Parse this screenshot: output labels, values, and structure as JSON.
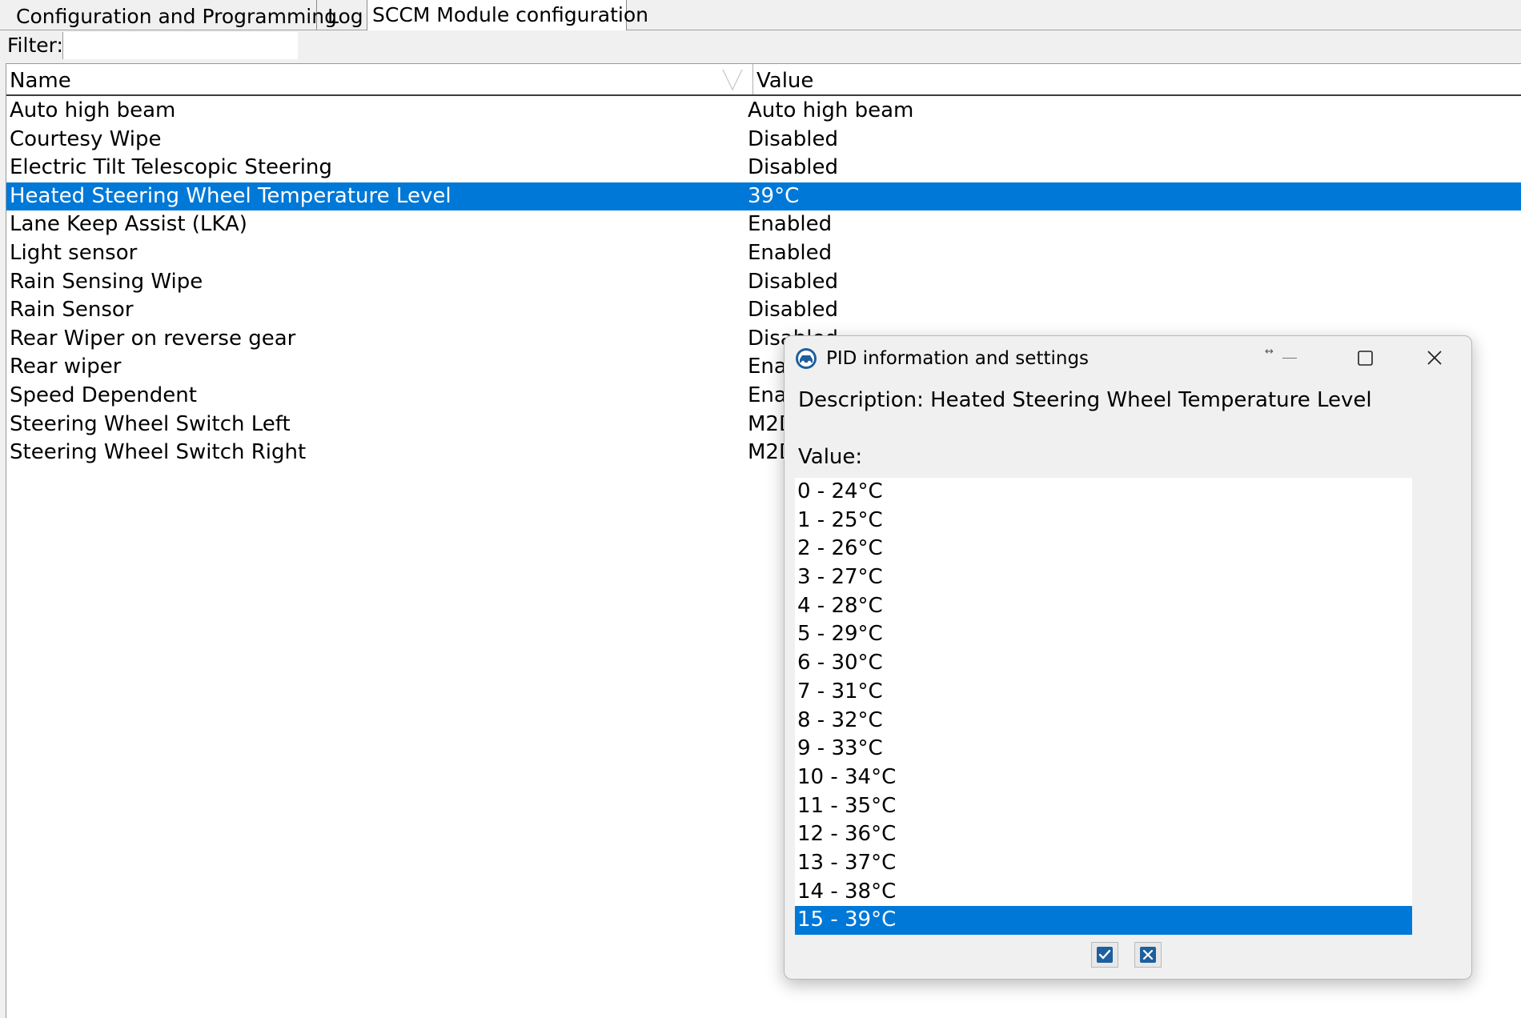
{
  "tabs": [
    {
      "label": "Configuration and Programming"
    },
    {
      "label": "Log"
    },
    {
      "label": "SCCM Module configuration"
    }
  ],
  "filter": {
    "label": "Filter:",
    "value": ""
  },
  "grid": {
    "columns": [
      "Name",
      "Value"
    ],
    "rows": [
      {
        "name": "Auto high beam",
        "value": "Auto high beam"
      },
      {
        "name": "Courtesy Wipe",
        "value": "Disabled"
      },
      {
        "name": "Electric Tilt Telescopic Steering",
        "value": "Disabled"
      },
      {
        "name": "Heated Steering Wheel Temperature Level",
        "value": "39°C"
      },
      {
        "name": "Lane Keep Assist (LKA)",
        "value": "Enabled"
      },
      {
        "name": "Light sensor",
        "value": "Enabled"
      },
      {
        "name": "Rain Sensing Wipe",
        "value": "Disabled"
      },
      {
        "name": "Rain Sensor",
        "value": "Disabled"
      },
      {
        "name": "Rear Wiper on reverse gear",
        "value": "Disabled"
      },
      {
        "name": "Rear wiper",
        "value": "Enabled"
      },
      {
        "name": "Speed Dependent",
        "value": "Enabled"
      },
      {
        "name": "Steering Wheel Switch Left",
        "value": "M2D"
      },
      {
        "name": "Steering Wheel Switch Right",
        "value": "M2D"
      }
    ],
    "selected_row": "Heated Steering Wheel Temperature Level"
  },
  "dialog": {
    "title": "PID information and settings",
    "description": "Description: Heated Steering Wheel Temperature Level",
    "value_label": "Value:",
    "options": [
      "0 - 24°C",
      "1 - 25°C",
      "2 - 26°C",
      "3 - 27°C",
      "4 - 28°C",
      "5 - 29°C",
      "6 - 30°C",
      "7 - 31°C",
      "8 - 32°C",
      "9 - 33°C",
      "10 - 34°C",
      "11 - 35°C",
      "12 - 36°C",
      "13 - 37°C",
      "14 - 38°C",
      "15 - 39°C"
    ],
    "selected_option": "15 - 39°C",
    "ok_icon": "check-icon",
    "cancel_icon": "x-icon"
  },
  "colors": {
    "selection": "#0078d7",
    "window_bg": "#f0f0f0",
    "grid_bg": "#ffffff",
    "button_icon": "#1e5f9e"
  }
}
